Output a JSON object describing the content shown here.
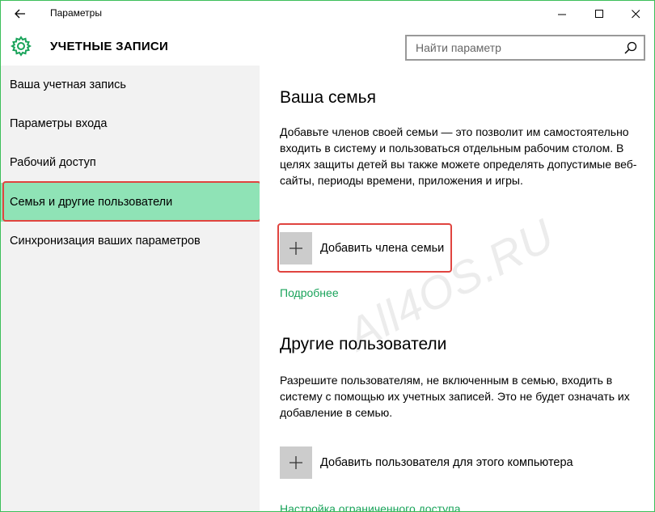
{
  "window": {
    "title": "Параметры",
    "border_color": "#3cbf5a"
  },
  "header": {
    "title": "УЧЕТНЫЕ ЗАПИСИ",
    "search_placeholder": "Найти параметр"
  },
  "sidebar": {
    "items": [
      {
        "label": "Ваша учетная запись",
        "active": false
      },
      {
        "label": "Параметры входа",
        "active": false
      },
      {
        "label": "Рабочий доступ",
        "active": false
      },
      {
        "label": "Семья и другие пользователи",
        "active": true
      },
      {
        "label": "Синхронизация ваших параметров",
        "active": false
      }
    ]
  },
  "family": {
    "title": "Ваша семья",
    "description": "Добавьте членов своей семьи — это позволит им самостоятельно входить в систему и пользоваться отдельным рабочим столом. В целях защиты детей вы также можете определять допустимые веб-сайты, периоды времени, приложения и игры.",
    "add_label": "Добавить члена семьи",
    "more_link": "Подробнее"
  },
  "others": {
    "title": "Другие пользователи",
    "description": "Разрешите пользователям, не включенным в семью, входить в систему с помощью их учетных записей. Это не будет означать их добавление в семью.",
    "add_label": "Добавить пользователя для этого компьютера",
    "restricted_link": "Настройка ограниченного доступа"
  },
  "watermark": "All4OS.RU",
  "colors": {
    "accent_active": "#8fe3b6",
    "link": "#19a35a",
    "highlight_box": "#e0443f"
  }
}
